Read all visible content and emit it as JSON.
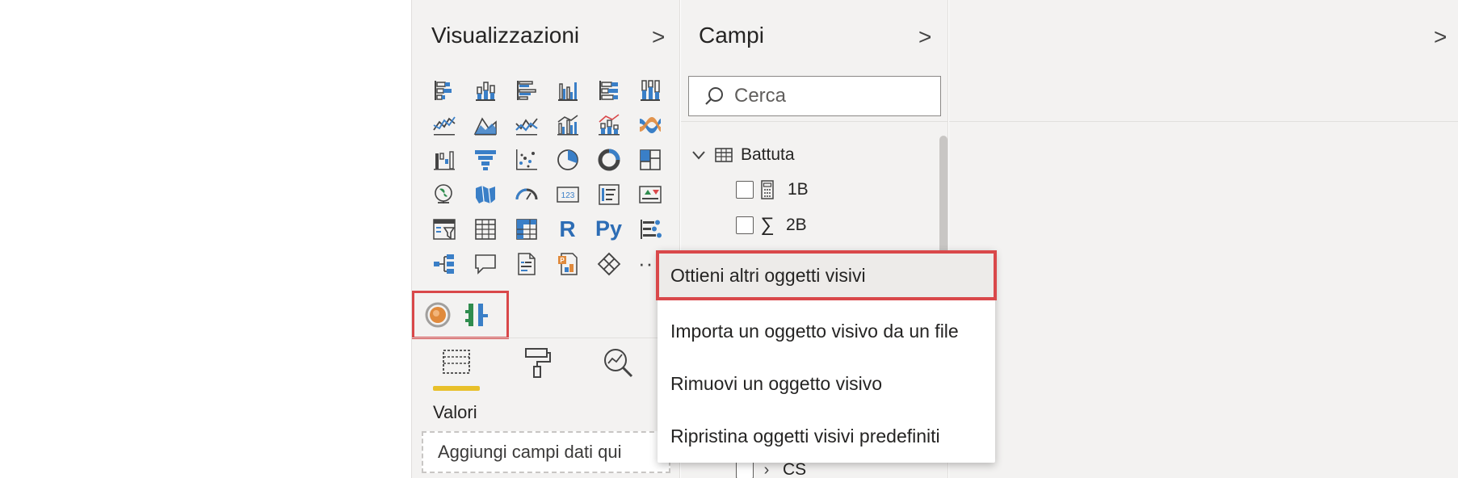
{
  "visualizations_pane": {
    "title": "Visualizzazioni",
    "chevron": ">",
    "visual_icons": [
      "stacked-bar-icon",
      "stacked-column-icon",
      "clustered-bar-icon",
      "clustered-column-icon",
      "100-stacked-bar-icon",
      "100-stacked-column-icon",
      "line-chart-icon",
      "area-chart-icon",
      "stacked-area-icon",
      "line-clustered-column-icon",
      "line-stacked-column-icon",
      "ribbon-chart-icon",
      "waterfall-icon",
      "funnel-icon",
      "scatter-icon",
      "pie-chart-icon",
      "donut-chart-icon",
      "treemap-icon",
      "map-icon",
      "filled-map-icon",
      "gauge-icon",
      "card-icon",
      "multirow-card-icon",
      "kpi-icon",
      "slicer-icon",
      "table-icon",
      "matrix-icon",
      "r-visual-icon",
      "python-visual-icon",
      "key-influencers-icon",
      "decomposition-tree-icon",
      "qa-icon",
      "smart-narrative-icon",
      "paginated-report-icon",
      "power-apps-icon",
      "more-icon"
    ],
    "r_label": "R",
    "py_label": "Py",
    "more_label": "···",
    "custom_visual_icons": [
      "custom-visual-circle-icon",
      "custom-visual-bars-icon"
    ],
    "sub_tabs": [
      "fields-tab-icon",
      "format-paint-icon",
      "analytics-icon"
    ],
    "values_label": "Valori",
    "drop_zone": "Aggiungi campi dati qui"
  },
  "fields_pane": {
    "title": "Campi",
    "chevron": ">",
    "search_placeholder": "Cerca",
    "table_name": "Battuta",
    "fields": [
      {
        "name": "1B",
        "icon": "calculator-icon"
      },
      {
        "name": "2B",
        "icon": "sigma-icon"
      }
    ],
    "bottom_field": "CS"
  },
  "right_pane": {
    "chevron": ">"
  },
  "context_menu": {
    "items": [
      "Ottieni altri oggetti visivi",
      "Importa un oggetto visivo da un file",
      "Rimuovi un oggetto visivo",
      "Ripristina oggetti visivi predefiniti"
    ]
  },
  "colors": {
    "accent_blue": "#3a7fc7",
    "highlight_red": "#d9484a",
    "tab_underline": "#e8c02a",
    "pane_bg": "#f3f2f1"
  }
}
